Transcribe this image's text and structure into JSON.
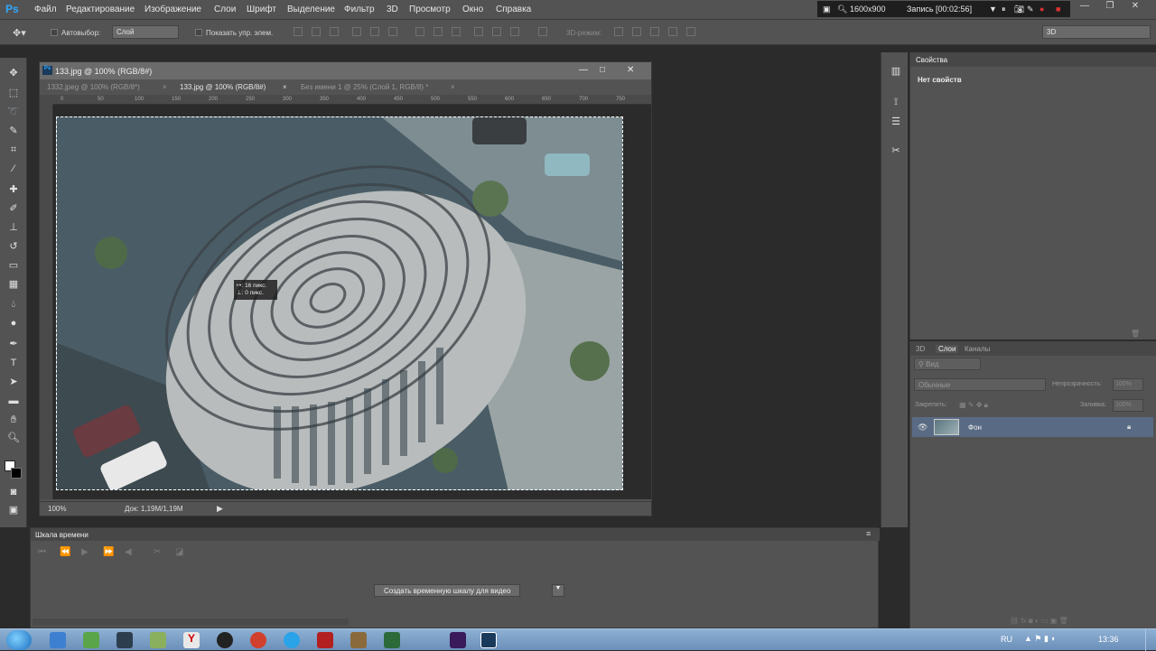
{
  "app": {
    "logo": "Ps"
  },
  "menu": [
    "Файл",
    "Редактирование",
    "Изображение",
    "Слои",
    "Шрифт",
    "Выделение",
    "Фильтр",
    "3D",
    "Просмотр",
    "Окно",
    "Справка"
  ],
  "recorder": {
    "resolution": "1600x900",
    "status": "Запись [00:02:56]"
  },
  "options_bar": {
    "autoselect_label": "Автовыбор:",
    "autoselect_value": "Слой",
    "show_transform_label": "Показать упр. элем.",
    "mode_3d_label": "3D-режим:",
    "workspace_value": "3D"
  },
  "document": {
    "title": "133.jpg @ 100% (RGB/8#)",
    "tabs": [
      {
        "label": "1332.jpeg @ 100% (RGB/8*)",
        "active": false
      },
      {
        "label": "133.jpg @ 100% (RGB/8#)",
        "active": true
      },
      {
        "label": "Без имени 1 @ 25% (Слой 1, RGB/8) *",
        "active": false
      }
    ],
    "ruler_ticks": [
      "0",
      "50",
      "100",
      "150",
      "200",
      "250",
      "300",
      "350",
      "400",
      "450",
      "500",
      "550",
      "600",
      "650",
      "700",
      "750"
    ],
    "tooltip_x": "16 пикс.",
    "tooltip_y": "0 пикс.",
    "zoom": "100%",
    "doc_size": "Док: 1,19M/1,19M"
  },
  "properties_panel": {
    "title": "Свойства",
    "body": "Нет свойств"
  },
  "layers_panel": {
    "tabs": [
      {
        "label": "3D",
        "active": false
      },
      {
        "label": "Слои",
        "active": true
      },
      {
        "label": "Каналы",
        "active": false
      }
    ],
    "filter_label": "Вид",
    "blend_mode": "Обычные",
    "opacity_label": "Непрозрачность:",
    "opacity_value": "100%",
    "lock_label": "Закрепить:",
    "fill_label": "Заливка:",
    "fill_value": "100%",
    "layers": [
      {
        "name": "Фон",
        "visible": true,
        "locked": true
      }
    ]
  },
  "timeline": {
    "title": "Шкала времени",
    "create_button": "Создать временную шкалу для видео"
  },
  "taskbar": {
    "language": "RU",
    "clock": "13:36"
  },
  "colors": {
    "panel_bg": "#535353",
    "workspace_bg": "#2b2b2b",
    "layer_selected": "#596b84",
    "ps_blue": "#31a8ff"
  }
}
